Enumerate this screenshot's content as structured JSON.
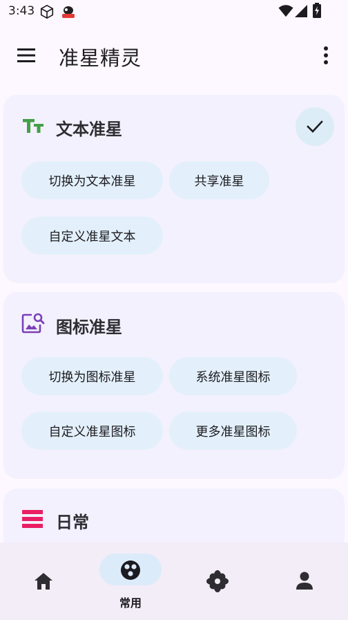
{
  "status_bar": {
    "time": "3:43"
  },
  "app_bar": {
    "title": "准星精灵"
  },
  "cards": [
    {
      "title": "文本准星",
      "icon": "text-icon",
      "chips": [
        "切换为文本准星",
        "共享准星",
        "自定义准星文本"
      ],
      "selected": true
    },
    {
      "title": "图标准星",
      "icon": "image-search-icon",
      "chips": [
        "切换为图标准星",
        "系统准星图标",
        "自定义准星图标",
        "更多准星图标"
      ]
    },
    {
      "title": "日常",
      "icon": "list-icon"
    }
  ],
  "bottom_nav": {
    "items": [
      {
        "icon": "home-icon",
        "label": ""
      },
      {
        "icon": "dots-circle-icon",
        "label": "常用",
        "active": true
      },
      {
        "icon": "flower-icon",
        "label": ""
      },
      {
        "icon": "person-icon",
        "label": ""
      }
    ]
  },
  "colors": {
    "text_icon_green": "#43a047",
    "image_icon_purple": "#7b3fb8",
    "list_icon_red": "#e91e63",
    "chip_bg": "#e3f0fb",
    "card_bg": "#f3f1fd"
  }
}
